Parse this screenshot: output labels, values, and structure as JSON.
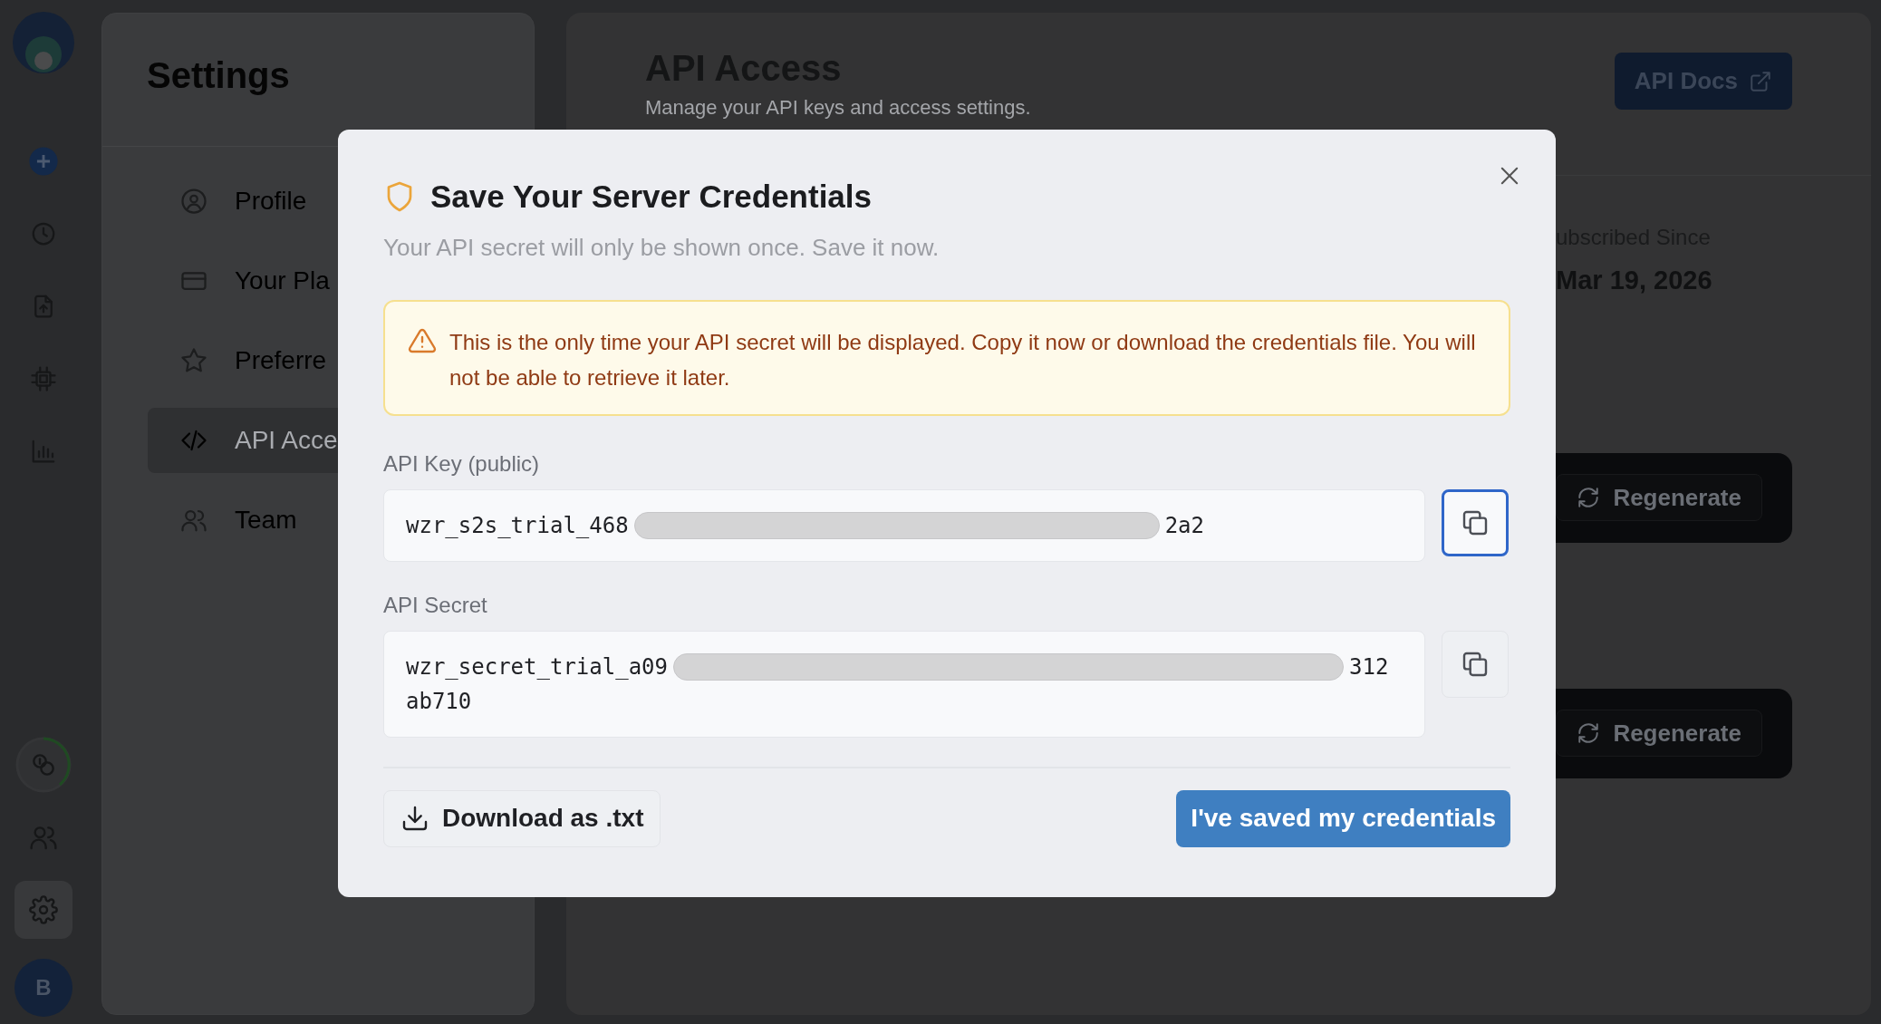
{
  "rail": {
    "items": [
      {
        "kind": "plus",
        "selected": false
      },
      {
        "kind": "clock",
        "selected": false
      },
      {
        "kind": "file",
        "selected": false
      },
      {
        "kind": "chip",
        "selected": false
      },
      {
        "kind": "chart",
        "selected": false
      }
    ],
    "bottom": [
      {
        "kind": "coins",
        "selected": false
      },
      {
        "kind": "users",
        "selected": false
      },
      {
        "kind": "gear",
        "selected": true
      }
    ],
    "avatar": "B"
  },
  "settings": {
    "title": "Settings",
    "items": [
      {
        "kind": "user",
        "label": "Profile",
        "selected": false
      },
      {
        "kind": "card",
        "label": "Your Pla",
        "selected": false
      },
      {
        "kind": "star",
        "label": "Preferre",
        "selected": false
      },
      {
        "kind": "code",
        "label": "API Acce",
        "selected": true
      },
      {
        "kind": "users",
        "label": "Team",
        "selected": false
      }
    ]
  },
  "main": {
    "title": "API Access",
    "subtitle": "Manage your API keys and access settings.",
    "docs_button": "API Docs",
    "subscribed_label": "ubscribed Since",
    "subscribed_value": "Mar 19, 2026",
    "regenerate_buttons": [
      "Regenerate",
      "Regenerate"
    ]
  },
  "dialog": {
    "title": "Save Your Server Credentials",
    "subtitle": "Your API secret will only be shown once. Save it now.",
    "warning": "This is the only time your API secret will be displayed. Copy it now or download the credentials file. You will not be able to retrieve it later.",
    "fields": [
      {
        "label": "API Key (public)",
        "before": "wzr_s2s_trial_468",
        "after": "2a2",
        "copy_focused": true
      },
      {
        "label": "API Secret",
        "before": "wzr_secret_trial_a09",
        "after": "312",
        "second_line": "ab710",
        "copy_focused": false
      }
    ],
    "download_button": "Download as .txt",
    "confirm_button": "I've saved my credentials"
  }
}
